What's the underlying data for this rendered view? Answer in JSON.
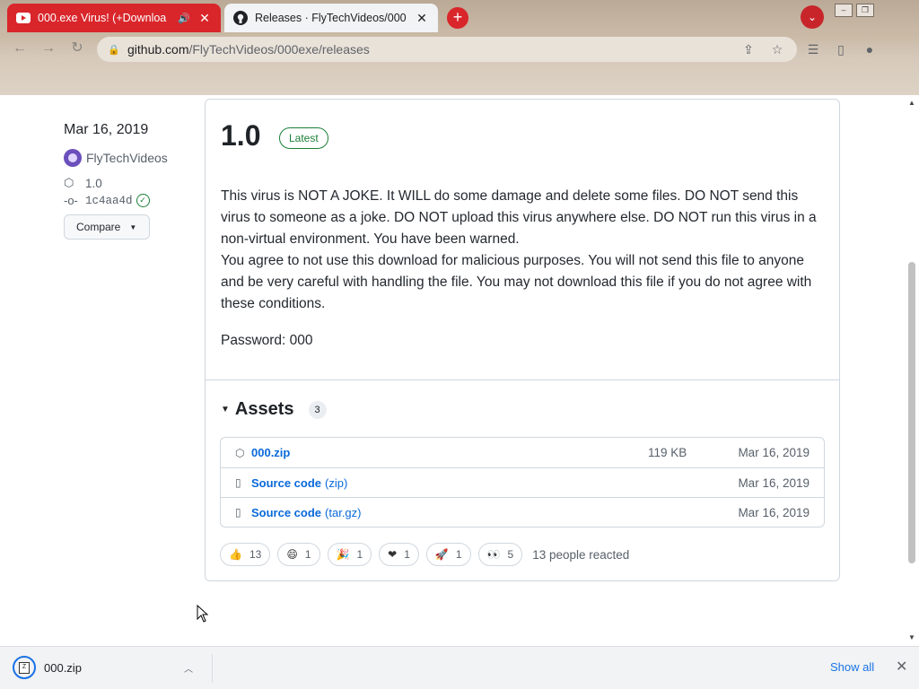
{
  "browser": {
    "tabs": [
      {
        "title": "000.exe Virus! (+Downloa",
        "state": "inactive",
        "icon": "youtube-icon"
      },
      {
        "title": "Releases · FlyTechVideos/000",
        "state": "active",
        "icon": "github-icon"
      }
    ],
    "url_host": "github.com",
    "url_path": "/FlyTechVideos/000exe/releases"
  },
  "release": {
    "date": "Mar 16, 2019",
    "author": "FlyTechVideos",
    "tag": "1.0",
    "commit": "1c4aa4d",
    "compare_label": "Compare",
    "title": "1.0",
    "badge": "Latest",
    "body": "This virus is NOT A JOKE. It WILL do some damage and delete some files. DO NOT send this virus to someone as a joke. DO NOT upload this virus anywhere else. DO NOT run this virus in a non-virtual environment. You have been warned.",
    "body2": "You agree to not use this download for malicious purposes. You will not send this file to anyone and be very careful with handling the file. You may not download this file if you do not agree with these conditions.",
    "password": "Password: 000"
  },
  "assets": {
    "label": "Assets",
    "count": "3",
    "items": [
      {
        "name": "000.zip",
        "ext": "",
        "size": "119 KB",
        "date": "Mar 16, 2019",
        "icon": "package-icon"
      },
      {
        "name": "Source code",
        "ext": "(zip)",
        "size": "",
        "date": "Mar 16, 2019",
        "icon": "file-zip-icon"
      },
      {
        "name": "Source code",
        "ext": "(tar.gz)",
        "size": "",
        "date": "Mar 16, 2019",
        "icon": "file-zip-icon"
      }
    ]
  },
  "reactions": {
    "items": [
      {
        "emoji": "👍",
        "count": "13",
        "icon": "thumbs-up-icon"
      },
      {
        "emoji": "😄",
        "count": "1",
        "icon": "smile-icon"
      },
      {
        "emoji": "🎉",
        "count": "1",
        "icon": "tada-icon"
      },
      {
        "emoji": "❤",
        "count": "1",
        "icon": "heart-icon"
      },
      {
        "emoji": "🚀",
        "count": "1",
        "icon": "rocket-icon"
      },
      {
        "emoji": "👀",
        "count": "5",
        "icon": "eyes-icon"
      }
    ],
    "summary": "13 people reacted"
  },
  "downloads": {
    "file": "000.zip",
    "show_all": "Show all"
  }
}
